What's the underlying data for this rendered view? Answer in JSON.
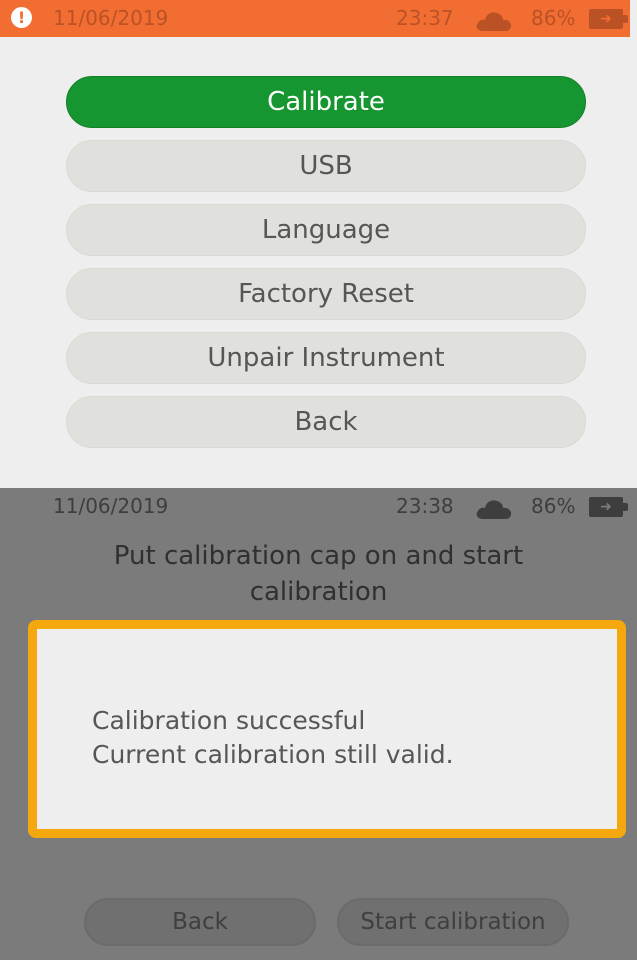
{
  "top": {
    "status": {
      "date": "11/06/2019",
      "time": "23:37",
      "battery": "86%",
      "alert_icon": "exclamation-alert-icon",
      "cloud_icon": "cloud-icon",
      "battery_icon": "battery-charging-icon"
    },
    "menu": [
      {
        "label": "Calibrate",
        "selected": true
      },
      {
        "label": "USB",
        "selected": false
      },
      {
        "label": "Language",
        "selected": false
      },
      {
        "label": "Factory Reset",
        "selected": false
      },
      {
        "label": "Unpair Instrument",
        "selected": false
      },
      {
        "label": "Back",
        "selected": false
      }
    ],
    "colors": {
      "status_bar": "#f26d32",
      "selected": "#169630",
      "button": "#e0e1dc"
    }
  },
  "bottom": {
    "status": {
      "date": "11/06/2019",
      "time": "23:38",
      "battery": "86%",
      "cloud_icon": "cloud-icon",
      "battery_icon": "battery-charging-icon"
    },
    "prompt_line1": "Put calibration cap on and start",
    "prompt_line2": "calibration",
    "dialog": {
      "line1": "Calibration successful",
      "line2": "Current calibration still valid.",
      "border_color": "#f5a80d"
    },
    "back_label": "Back",
    "start_label": "Start calibration"
  }
}
